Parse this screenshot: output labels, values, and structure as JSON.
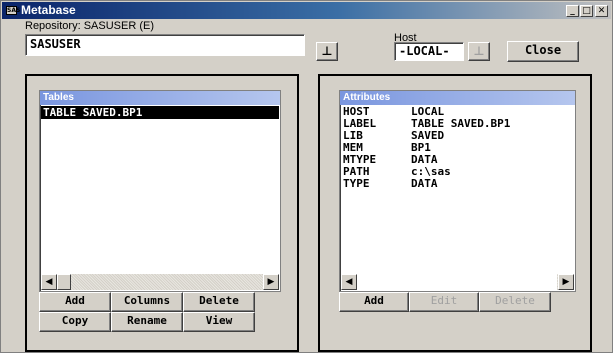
{
  "window": {
    "title": "Metabase",
    "app_icon_text": "SAS"
  },
  "title_buttons": {
    "minimize": "_",
    "maximize": "□",
    "close": "✕"
  },
  "repository": {
    "label": "Repository: SASUSER (E)",
    "value": "SASUSER"
  },
  "host": {
    "label": "Host",
    "value": "-LOCAL-"
  },
  "close_button": "Close",
  "tables": {
    "header": "Tables",
    "items": [
      "TABLE SAVED.BP1"
    ],
    "selected_index": 0,
    "buttons": [
      "Add",
      "Columns",
      "Delete",
      "Copy",
      "Rename",
      "View"
    ]
  },
  "attributes": {
    "header": "Attributes",
    "rows": [
      {
        "key": "HOST",
        "value": "LOCAL"
      },
      {
        "key": "LABEL",
        "value": "TABLE SAVED.BP1"
      },
      {
        "key": "LIB",
        "value": "SAVED"
      },
      {
        "key": "MEM",
        "value": "BP1"
      },
      {
        "key": "MTYPE",
        "value": "DATA"
      },
      {
        "key": "PATH",
        "value": "c:\\sas"
      },
      {
        "key": "TYPE",
        "value": "DATA"
      }
    ],
    "buttons": [
      {
        "label": "Add",
        "enabled": true
      },
      {
        "label": "Edit",
        "enabled": false
      },
      {
        "label": "Delete",
        "enabled": false
      }
    ]
  },
  "icons": {
    "dropdown": "down-arrow-icon",
    "scroll_left": "left-arrow-icon",
    "scroll_right": "right-arrow-icon"
  },
  "colors": {
    "title_start": "#0a246a",
    "selection": "#000000",
    "list_header": "#7a96df"
  }
}
